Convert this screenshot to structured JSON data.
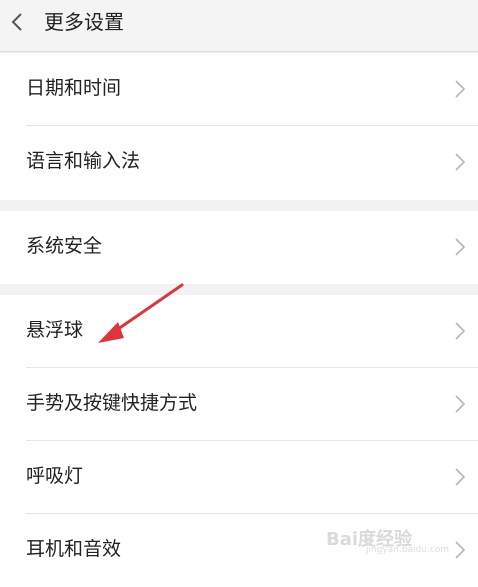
{
  "header": {
    "back_icon": "chevron-left-icon",
    "title": "更多设置"
  },
  "groups": [
    {
      "items": [
        {
          "label": "日期和时间"
        },
        {
          "label": "语言和输入法"
        }
      ]
    },
    {
      "items": [
        {
          "label": "系统安全"
        }
      ]
    },
    {
      "items": [
        {
          "label": "悬浮球"
        },
        {
          "label": "手势及按键快捷方式"
        },
        {
          "label": "呼吸灯"
        },
        {
          "label": "耳机和音效"
        }
      ]
    }
  ],
  "colors": {
    "background": "#f2f2f2",
    "row_background": "#ffffff",
    "annotation_arrow": "#e0343b"
  },
  "watermark": {
    "main": "Bai度经验",
    "sub": "jingyan.baidu.com"
  }
}
